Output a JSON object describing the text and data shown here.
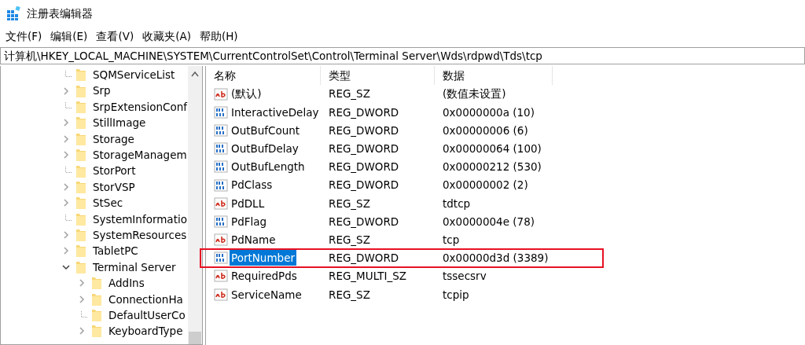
{
  "window": {
    "title": "注册表编辑器"
  },
  "menu": [
    {
      "label": "文件(F)"
    },
    {
      "label": "编辑(E)"
    },
    {
      "label": "查看(V)"
    },
    {
      "label": "收藏夹(A)"
    },
    {
      "label": "帮助(H)"
    }
  ],
  "address": "计算机\\HKEY_LOCAL_MACHINE\\SYSTEM\\CurrentControlSet\\Control\\Terminal Server\\Wds\\rdpwd\\Tds\\tcp",
  "tree": [
    {
      "label": "SQMServiceList",
      "kind": "leaf"
    },
    {
      "label": "Srp",
      "kind": "branch",
      "expanded": false
    },
    {
      "label": "SrpExtensionConf",
      "kind": "leaf"
    },
    {
      "label": "StillImage",
      "kind": "branch",
      "expanded": false
    },
    {
      "label": "Storage",
      "kind": "branch",
      "expanded": false
    },
    {
      "label": "StorageManagem",
      "kind": "branch",
      "expanded": false
    },
    {
      "label": "StorPort",
      "kind": "leaf"
    },
    {
      "label": "StorVSP",
      "kind": "branch",
      "expanded": false
    },
    {
      "label": "StSec",
      "kind": "branch",
      "expanded": false
    },
    {
      "label": "SystemInformatio",
      "kind": "leaf"
    },
    {
      "label": "SystemResources",
      "kind": "branch",
      "expanded": false
    },
    {
      "label": "TabletPC",
      "kind": "branch",
      "expanded": false
    },
    {
      "label": "Terminal Server",
      "kind": "branch",
      "expanded": true,
      "children": [
        {
          "label": "AddIns",
          "kind": "branch",
          "expanded": false
        },
        {
          "label": "ConnectionHa",
          "kind": "branch",
          "expanded": false
        },
        {
          "label": "DefaultUserCo",
          "kind": "leaf"
        },
        {
          "label": "KeyboardType",
          "kind": "branch",
          "expanded": false
        }
      ]
    }
  ],
  "columns": [
    "名称",
    "类型",
    "数据"
  ],
  "values": [
    {
      "name": "(默认)",
      "type": "REG_SZ",
      "data": "(数值未设置)",
      "kind": "string",
      "selected": false,
      "annotated": false
    },
    {
      "name": "InteractiveDelay",
      "type": "REG_DWORD",
      "data": "0x0000000a (10)",
      "kind": "binary",
      "selected": false,
      "annotated": false
    },
    {
      "name": "OutBufCount",
      "type": "REG_DWORD",
      "data": "0x00000006 (6)",
      "kind": "binary",
      "selected": false,
      "annotated": false
    },
    {
      "name": "OutBufDelay",
      "type": "REG_DWORD",
      "data": "0x00000064 (100)",
      "kind": "binary",
      "selected": false,
      "annotated": false
    },
    {
      "name": "OutBufLength",
      "type": "REG_DWORD",
      "data": "0x00000212 (530)",
      "kind": "binary",
      "selected": false,
      "annotated": false
    },
    {
      "name": "PdClass",
      "type": "REG_DWORD",
      "data": "0x00000002 (2)",
      "kind": "binary",
      "selected": false,
      "annotated": false
    },
    {
      "name": "PdDLL",
      "type": "REG_SZ",
      "data": "tdtcp",
      "kind": "string",
      "selected": false,
      "annotated": false
    },
    {
      "name": "PdFlag",
      "type": "REG_DWORD",
      "data": "0x0000004e (78)",
      "kind": "binary",
      "selected": false,
      "annotated": false
    },
    {
      "name": "PdName",
      "type": "REG_SZ",
      "data": "tcp",
      "kind": "string",
      "selected": false,
      "annotated": false
    },
    {
      "name": "PortNumber",
      "type": "REG_DWORD",
      "data": "0x00000d3d (3389)",
      "kind": "binary",
      "selected": true,
      "annotated": true
    },
    {
      "name": "RequiredPds",
      "type": "REG_MULTI_SZ",
      "data": "tssecsrv",
      "kind": "string",
      "selected": false,
      "annotated": false
    },
    {
      "name": "ServiceName",
      "type": "REG_SZ",
      "data": "tcpip",
      "kind": "string",
      "selected": false,
      "annotated": false
    }
  ]
}
